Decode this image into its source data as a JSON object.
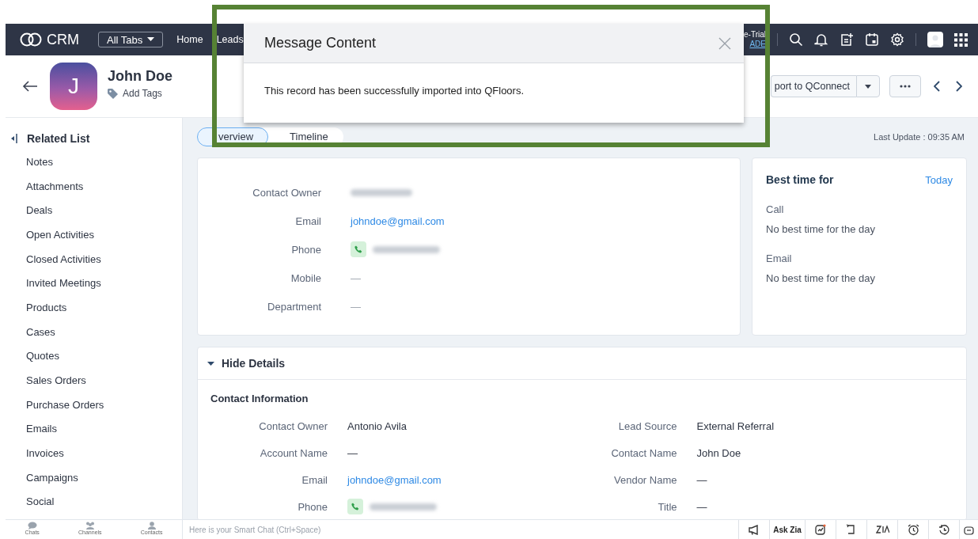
{
  "top_bar": {
    "logo": "CRM",
    "all_tabs": "All Tabs",
    "nav": [
      "Home",
      "Leads"
    ],
    "trial": "e-Trial",
    "upgrade": "ADE"
  },
  "record": {
    "name": "John Doe",
    "initial": "J",
    "add_tags": "Add Tags",
    "action_button": "port to QConnect"
  },
  "modal": {
    "title": "Message Content",
    "message": "This record has been successfully imported into QFloors."
  },
  "sidebar": {
    "title": "Related List",
    "items": [
      "Notes",
      "Attachments",
      "Deals",
      "Open Activities",
      "Closed Activities",
      "Invited Meetings",
      "Products",
      "Cases",
      "Quotes",
      "Sales Orders",
      "Purchase Orders",
      "Emails",
      "Invoices",
      "Campaigns",
      "Social"
    ]
  },
  "tabs": [
    {
      "label": "verview",
      "selected": true
    },
    {
      "label": "Timeline",
      "selected": false
    }
  ],
  "last_update": "Last Update : 09:35 AM",
  "summary_fields": [
    {
      "label": "Contact Owner",
      "kind": "redacted"
    },
    {
      "label": "Email",
      "kind": "link",
      "value": "johndoe@gmail.com"
    },
    {
      "label": "Phone",
      "kind": "phone"
    },
    {
      "label": "Mobile",
      "kind": "text",
      "value": "—"
    },
    {
      "label": "Department",
      "kind": "text",
      "value": "—"
    }
  ],
  "best_time": {
    "title": "Best time for",
    "link": "Today",
    "items": [
      {
        "label": "Call",
        "value": "No best time for the day"
      },
      {
        "label": "Email",
        "value": "No best time for the day"
      }
    ]
  },
  "details": {
    "toggle": "Hide Details",
    "expanded": true,
    "section": "Contact Information",
    "left": [
      {
        "label": "Contact Owner",
        "kind": "text",
        "value": "Antonio Avila"
      },
      {
        "label": "Account Name",
        "kind": "text",
        "value": "—"
      },
      {
        "label": "Email",
        "kind": "link",
        "value": "johndoe@gmail.com"
      },
      {
        "label": "Phone",
        "kind": "phone"
      }
    ],
    "right": [
      {
        "label": "Lead Source",
        "kind": "text",
        "value": "External Referral"
      },
      {
        "label": "Contact Name",
        "kind": "text",
        "value": "John Doe"
      },
      {
        "label": "Vendor Name",
        "kind": "text",
        "value": "—"
      },
      {
        "label": "Title",
        "kind": "text",
        "value": "—"
      }
    ]
  },
  "bottom_bar": {
    "tabs": [
      "Chats",
      "Channels",
      "Contacts"
    ],
    "chat_placeholder": "Here is your Smart Chat (Ctrl+Space)",
    "ask_zia": "Ask Zia"
  }
}
